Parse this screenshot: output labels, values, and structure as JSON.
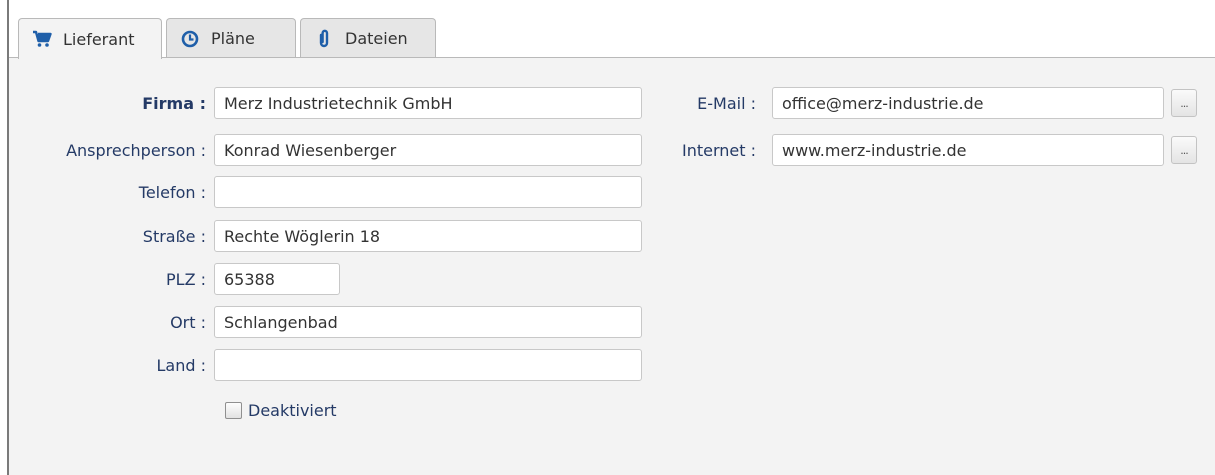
{
  "tabs": [
    {
      "label": "Lieferant",
      "icon": "shopping-cart-icon",
      "active": true
    },
    {
      "label": "Pläne",
      "icon": "clock-icon",
      "active": false
    },
    {
      "label": "Dateien",
      "icon": "paperclip-icon",
      "active": false
    }
  ],
  "form": {
    "firma": {
      "label": "Firma :",
      "value": "Merz Industrietechnik GmbH"
    },
    "ansprechperson": {
      "label": "Ansprechperson :",
      "value": "Konrad Wiesenberger"
    },
    "telefon": {
      "label": "Telefon :",
      "value": ""
    },
    "strasse": {
      "label": "Straße :",
      "value": "Rechte Wöglerin 18"
    },
    "plz": {
      "label": "PLZ :",
      "value": "65388"
    },
    "ort": {
      "label": "Ort :",
      "value": "Schlangenbad"
    },
    "land": {
      "label": "Land :",
      "value": ""
    },
    "email": {
      "label": "E-Mail :",
      "value": "office@merz-industrie.de",
      "button": "..."
    },
    "internet": {
      "label": "Internet :",
      "value": "www.merz-industrie.de",
      "button": "..."
    },
    "deaktiviert": {
      "label": "Deaktiviert",
      "checked": false
    }
  },
  "colors": {
    "accent": "#1f5fa9",
    "label": "#243a66"
  }
}
